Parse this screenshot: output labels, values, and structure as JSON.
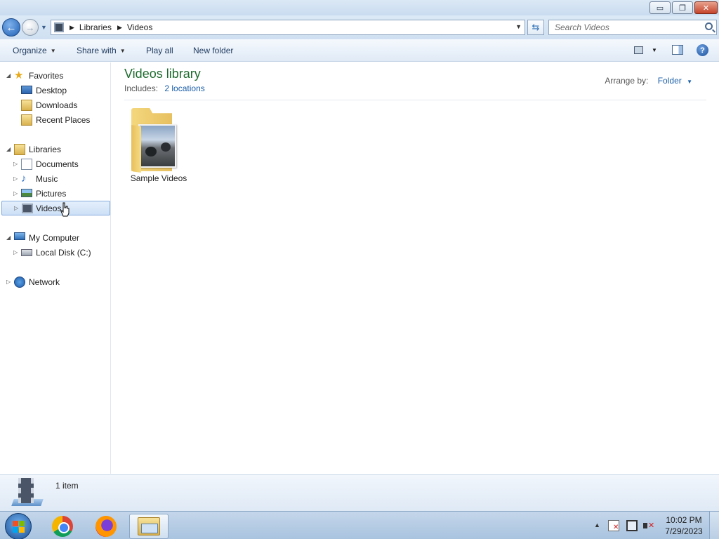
{
  "window": {
    "controls": {
      "minimize": "▭",
      "maximize": "❐",
      "close": "✕"
    }
  },
  "navigation": {
    "back_glyph": "←",
    "forward_glyph": "→",
    "recent_glyph": "▼"
  },
  "address_bar": {
    "icon": "videos-library-icon",
    "breadcrumbs": [
      "Libraries",
      "Videos"
    ],
    "separator": "▶",
    "dropdown_glyph": "▼",
    "refresh_glyph": "⇆"
  },
  "search": {
    "placeholder": "Search Videos"
  },
  "toolbar": {
    "organize": "Organize",
    "share_with": "Share with",
    "play_all": "Play all",
    "new_folder": "New folder",
    "caret": "▼",
    "help": "?"
  },
  "nav_pane": {
    "favorites": {
      "label": "Favorites",
      "items": [
        "Desktop",
        "Downloads",
        "Recent Places"
      ]
    },
    "libraries": {
      "label": "Libraries",
      "items": [
        "Documents",
        "Music",
        "Pictures",
        "Videos"
      ],
      "selected": "Videos"
    },
    "computer": {
      "label": "My Computer",
      "items": [
        "Local Disk (C:)"
      ]
    },
    "network": {
      "label": "Network"
    },
    "expanded_glyph": "◢",
    "collapsed_glyph": "▷"
  },
  "library_header": {
    "title": "Videos library",
    "includes_label": "Includes:",
    "locations_link": "2 locations",
    "arrange_label": "Arrange by:",
    "arrange_value": "Folder",
    "caret": "▼"
  },
  "items": [
    {
      "name": "Sample Videos",
      "icon": "folder-with-photo-icon"
    }
  ],
  "details_pane": {
    "count": "1 item"
  },
  "taskbar": {
    "apps": [
      "chrome-icon",
      "firefox-icon",
      "windows-explorer-icon"
    ],
    "tray_arrow": "▲",
    "time": "10:02 PM",
    "date": "7/29/2023"
  },
  "colors": {
    "library_title": "#1e6b2e",
    "link": "#1a5ea8",
    "selection_border": "#84acdd"
  }
}
